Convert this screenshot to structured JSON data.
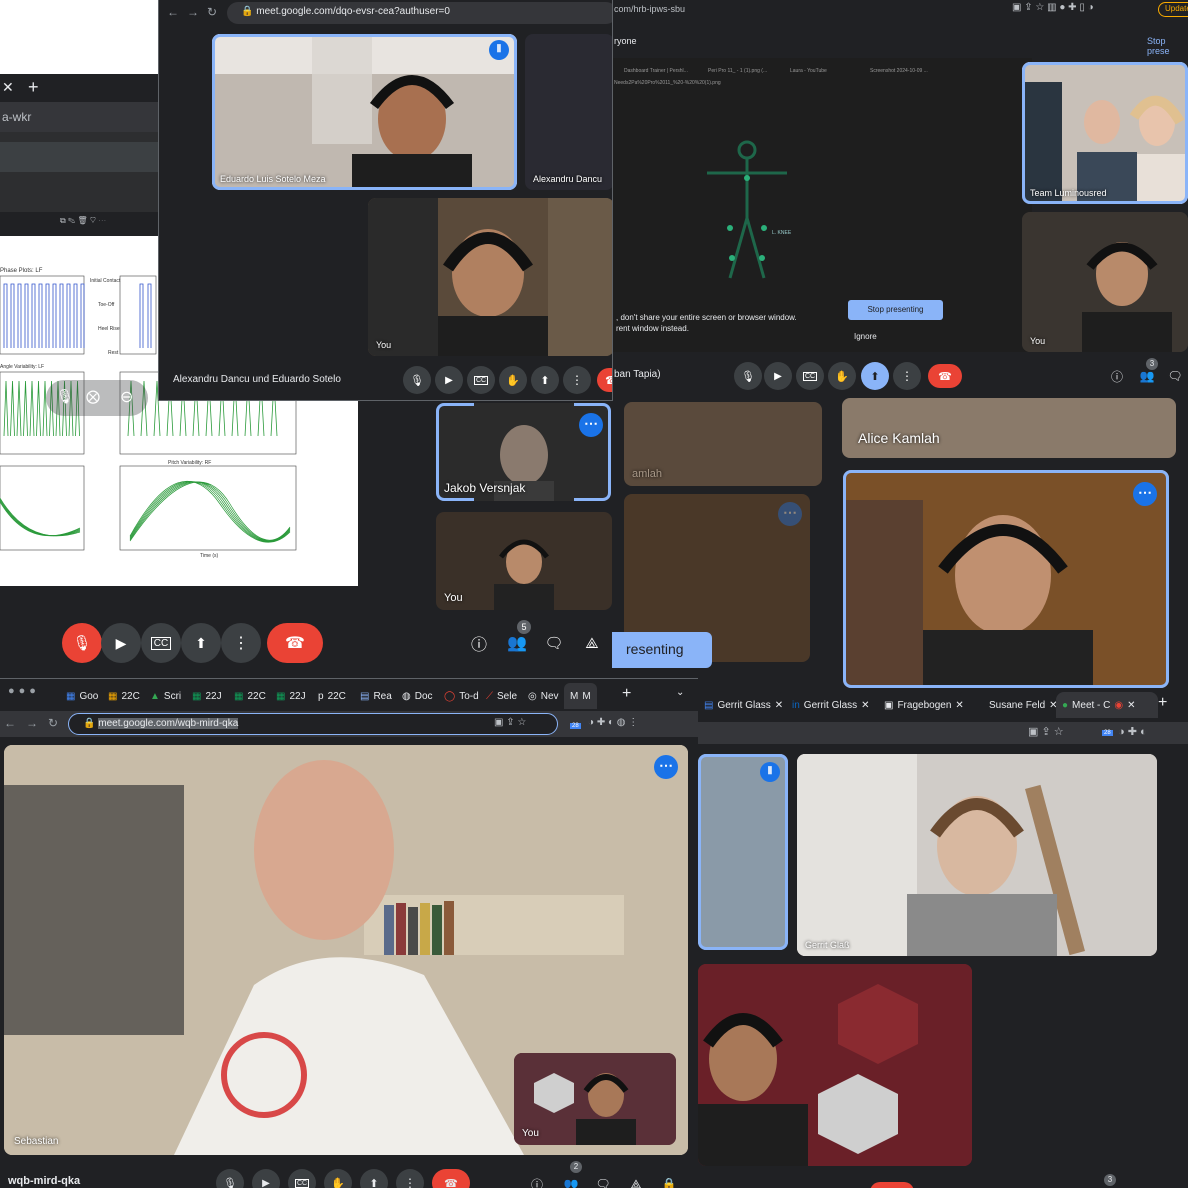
{
  "w1": {
    "tabs": [
      "Goo",
      "22C",
      "Scri",
      "22J",
      "22C",
      "22J",
      "22C",
      "Rea",
      "Doc",
      "To-d",
      "Sele",
      "Nev",
      "M"
    ],
    "url": "meet.google.com/wqb-mird-qka",
    "main_name": "Sebastian",
    "self_name": "You",
    "meeting_code": "wqb-mird-qka",
    "people_count": "2",
    "calendar_badge": "28"
  },
  "w2": {
    "url": "meet.google.com/dqo-evsr-cea?authuser=0",
    "tile1_name": "Eduardo Luis Sotelo Meza",
    "tile2_name": "Alexandru Dancu",
    "self_name": "You",
    "meeting_title": "Alexandru Dancu und Eduardo Sotelo"
  },
  "w3": {
    "url_fragment": "com/hrb-ipws-sbu",
    "banner_left": "ryone",
    "banner_right": "Stop prese",
    "warning_line1": ", don't share your entire screen or browser window.",
    "warning_line2": "rent window instead.",
    "stop_presenting": "Stop presenting",
    "ignore": "Ignore",
    "tile1_name": "Team Luminousred",
    "self_name": "You",
    "bottom_name": "ban Tapia)",
    "people_count": "3",
    "screen_button": "Update",
    "inner_tabs": [
      "Dashboard Trainer | Pershl...",
      "Peri Pro 11_ - 1 (1).png (...",
      "Laura - YouTube",
      "Screenshot 2024-10-09 ..."
    ],
    "inner_url": "Needs2Pa%20Pro%2011_%20-%20%20(1).png",
    "knee_label": "L. KNEE"
  },
  "w4": {
    "tile_name": "Jakob Versnjak",
    "self_name": "You",
    "people_count": "5",
    "chart_titles": [
      "Phase Plots: LF",
      "Initial Contact",
      "Toe-Off",
      "Heel Rise",
      "Rest",
      "Angle Variability: LF",
      "Pitch Variability: RF"
    ],
    "legend": [
      "Mean",
      "Toe-Off",
      "Next Strike"
    ],
    "xlabel": "Time (s)"
  },
  "w5": {
    "tile1_name": "Alice Kamlah",
    "presenting": "resenting",
    "faded_name": "amlah"
  },
  "w6": {
    "tabs": [
      "Gerrit Glass",
      "Gerrit Glass",
      "Fragebogen",
      "Susane Feld",
      "Meet - C"
    ],
    "tile_name": "Gerrit Glaß",
    "people_count": "3",
    "calendar_badge": "28"
  },
  "w7": {
    "tab_label": "a-wkr"
  },
  "colors": {
    "accent": "#8ab4f8",
    "blue": "#1a73e8",
    "red": "#ea4335",
    "bg": "#202124"
  }
}
